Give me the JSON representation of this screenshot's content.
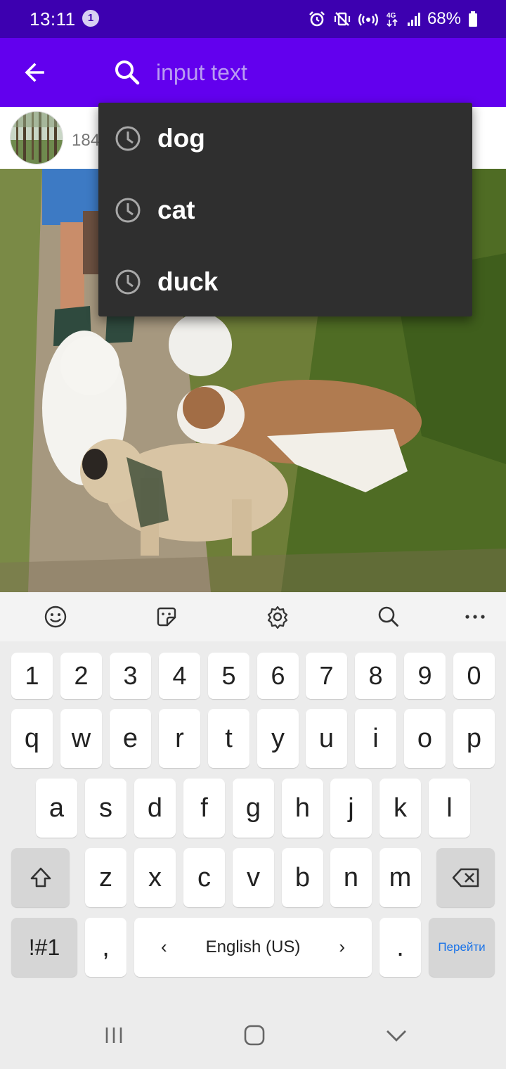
{
  "status_bar": {
    "time": "13:11",
    "notification_count": "1",
    "battery": "68%",
    "network": "4G"
  },
  "app_bar": {
    "search_placeholder": "input text",
    "search_value": ""
  },
  "result": {
    "count_partial": "184"
  },
  "suggestions": [
    {
      "label": "dog",
      "icon": "history-clock-icon"
    },
    {
      "label": "cat",
      "icon": "history-clock-icon"
    },
    {
      "label": "duck",
      "icon": "history-clock-icon"
    }
  ],
  "keyboard": {
    "number_row": [
      "1",
      "2",
      "3",
      "4",
      "5",
      "6",
      "7",
      "8",
      "9",
      "0"
    ],
    "row1": [
      "q",
      "w",
      "e",
      "r",
      "t",
      "y",
      "u",
      "i",
      "o",
      "p"
    ],
    "row2": [
      "a",
      "s",
      "d",
      "f",
      "g",
      "h",
      "j",
      "k",
      "l"
    ],
    "row3": [
      "z",
      "x",
      "c",
      "v",
      "b",
      "n",
      "m"
    ],
    "symbols_key": "!#1",
    "comma_key": ",",
    "language_label": "English (US)",
    "period_key": ".",
    "action_key": "Перейти"
  },
  "colors": {
    "status_bar": "#3d00b0",
    "app_bar": "#6200ee",
    "dropdown_bg": "#2f2f2f",
    "keyboard_bg": "#ececec",
    "action_text": "#1a73e8"
  }
}
